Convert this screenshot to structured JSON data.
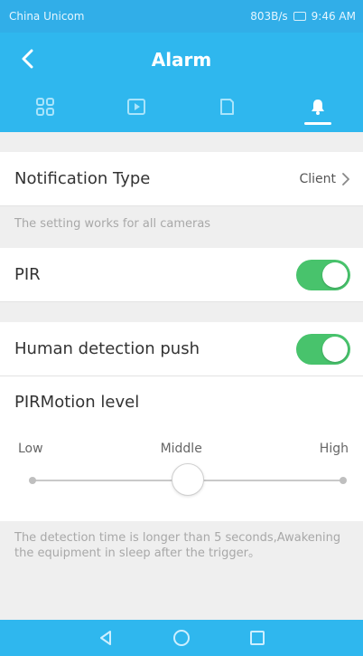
{
  "status_bar": {
    "carrier": "China Unicom",
    "speed": "803B/s",
    "time": "9:46 AM"
  },
  "header": {
    "title": "Alarm",
    "tabs": [
      {
        "icon": "grid-icon"
      },
      {
        "icon": "play-box-icon"
      },
      {
        "icon": "sd-card-icon"
      },
      {
        "icon": "bell-icon",
        "active": true
      }
    ]
  },
  "settings": {
    "notification_type": {
      "label": "Notification Type",
      "value": "Client"
    },
    "notification_hint": "The setting works for all cameras",
    "pir": {
      "label": "PIR",
      "enabled": true
    },
    "human_detection_push": {
      "label": "Human detection push",
      "enabled": true
    },
    "pir_motion_level": {
      "label": "PIRMotion level",
      "labels": {
        "low": "Low",
        "middle": "Middle",
        "high": "High"
      },
      "selected": "Middle"
    },
    "detection_note": "The detection time is longer than 5 seconds,Awakening the equipment in sleep after the trigger。"
  },
  "colors": {
    "primary": "#2fb7ee",
    "toggle_on": "#48c36c",
    "hint_text": "#a8a8a8"
  }
}
